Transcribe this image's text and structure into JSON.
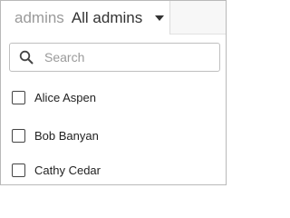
{
  "filter": {
    "key_label": "admins",
    "value_label": "All admins",
    "caret_icon": "caret-down-icon"
  },
  "search": {
    "placeholder": "Search",
    "value": "",
    "icon": "search-icon"
  },
  "admins": [
    {
      "name": "Alice Aspen",
      "checked": false
    },
    {
      "name": "Bob Banyan",
      "checked": false
    },
    {
      "name": "Cathy Cedar",
      "checked": false
    }
  ]
}
